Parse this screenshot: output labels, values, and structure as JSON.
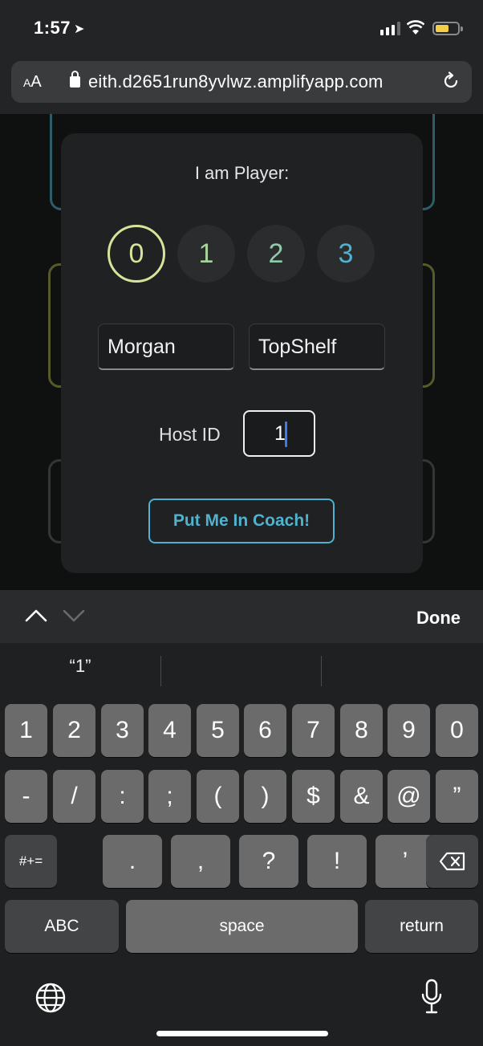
{
  "status": {
    "time": "1:57",
    "location_icon": "location-arrow-icon",
    "battery_color": "#f4cf45",
    "battery_level": 0.6
  },
  "browser": {
    "aa": "AA",
    "url": "eith.d2651run8yvlwz.amplifyapp.com"
  },
  "modal": {
    "title": "I am Player:",
    "players": [
      {
        "label": "0",
        "color": "#d4e49a",
        "selected": true
      },
      {
        "label": "1",
        "color": "#a9d39e",
        "selected": false
      },
      {
        "label": "2",
        "color": "#91c9ac",
        "selected": false
      },
      {
        "label": "3",
        "color": "#4fb2ce",
        "selected": false
      }
    ],
    "name_first": "Morgan",
    "name_second": "TopShelf",
    "host_label": "Host ID",
    "host_value": "1",
    "submit_label": "Put Me In Coach!"
  },
  "accessory": {
    "done_label": "Done"
  },
  "keyboard": {
    "suggestion": "“1”",
    "row1": [
      "1",
      "2",
      "3",
      "4",
      "5",
      "6",
      "7",
      "8",
      "9",
      "0"
    ],
    "row2": [
      "-",
      "/",
      ":",
      ";",
      "(",
      ")",
      "$",
      "&",
      "@",
      "”"
    ],
    "row3": [
      ".",
      ",",
      "?",
      "!",
      "’"
    ],
    "symbols_key": "#+=",
    "abc_key": "ABC",
    "space_key": "space",
    "return_key": "return"
  }
}
